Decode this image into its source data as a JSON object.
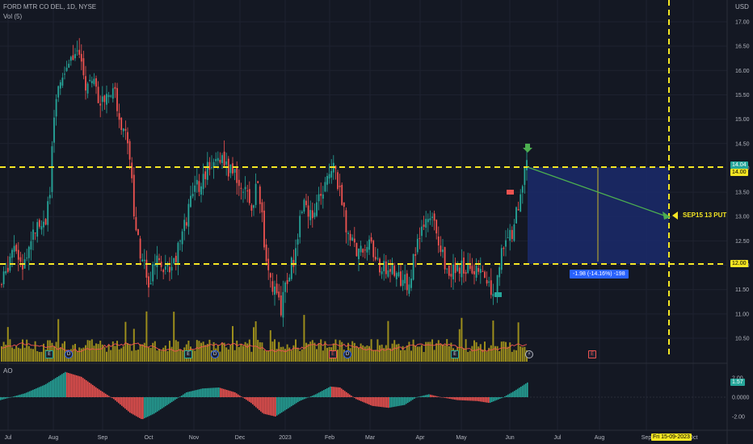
{
  "header": {
    "symbol_line": "FORD MTR CO DEL, 1D, NYSE",
    "vol_label": "Vol (5)",
    "ao_label": "AO",
    "currency": "USD"
  },
  "price_axis": [
    "17.00",
    "16.50",
    "16.00",
    "15.50",
    "15.00",
    "14.50",
    "14.00",
    "13.50",
    "13.00",
    "12.50",
    "12.00",
    "11.50",
    "11.00",
    "10.50"
  ],
  "ao_axis": [
    "2.00",
    "0.0000",
    "-2.00"
  ],
  "time_axis": [
    "Jul",
    "Aug",
    "Sep",
    "Oct",
    "Nov",
    "Dec",
    "2023",
    "Feb",
    "Mar",
    "Apr",
    "May",
    "Jun",
    "Jul",
    "Aug",
    "Sep",
    "Oct"
  ],
  "tags": {
    "last_price": "14.04",
    "level_upper": "14.00",
    "level_lower": "12.00",
    "ao_value": "1.57",
    "date_tag": "Fri 15-09-2023"
  },
  "annotations": {
    "target_label": "SEP15 13 PUT",
    "measure_label": "-1.98 (-14.16%) -198"
  },
  "colors": {
    "background": "#141823",
    "up": "#26a69a",
    "down": "#ef5350",
    "level_line": "#f5e623",
    "volume": "#9b8d1c",
    "range_box": "#1a2a6b",
    "arrow": "#4caf50"
  },
  "icons": [
    "earnings-icon",
    "dividend-icon",
    "flag-icon",
    "down-arrow-icon"
  ]
}
